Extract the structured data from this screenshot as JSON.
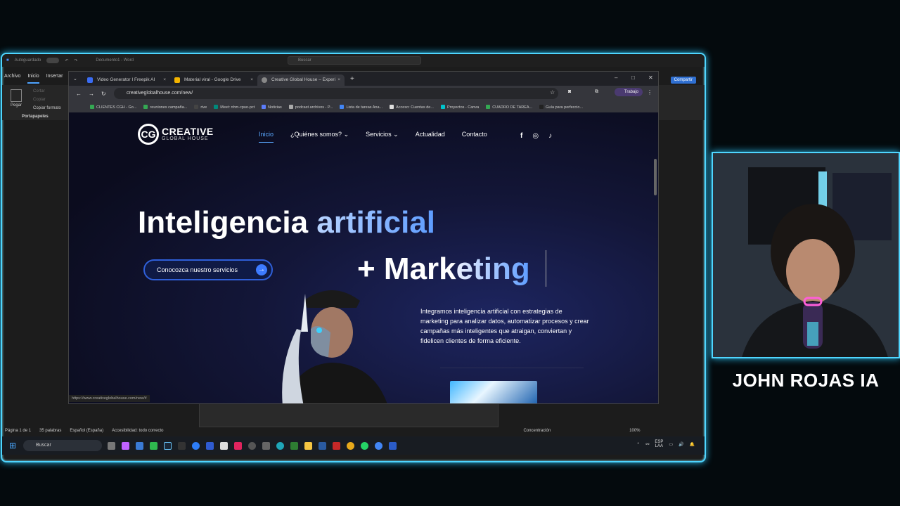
{
  "word": {
    "autosave_label": "Autoguardado",
    "title": "Documento1 - Word",
    "search_placeholder": "Buscar",
    "tabs": [
      "Archivo",
      "Inicio",
      "Insertar"
    ],
    "active_tab": "Inicio",
    "share_label": "Compartir",
    "ribbon": {
      "paste": "Pegar",
      "cut": "Cortar",
      "copy": "Copiar",
      "format": "Copiar formato",
      "group": "Portapapeles"
    },
    "status": {
      "page": "Página 1 de 1",
      "words": "35 palabras",
      "language": "Español (España)",
      "accessibility": "Accesibilidad: todo correcto",
      "focus": "Concentración",
      "zoom": "100%"
    }
  },
  "browser": {
    "tabs": [
      {
        "title": "Video Generator I Freepik AI",
        "color": "#3a6cf4"
      },
      {
        "title": "Material viral - Google Drive",
        "color": "#f4b400"
      },
      {
        "title": "Creative Global House – Experi",
        "color": "#888888"
      }
    ],
    "url": "creativeglobalhouse.com/new/",
    "profile_label": "Trabajo",
    "bookmarks": [
      {
        "label": "CLIENTES CGH - Go...",
        "color": "#34a853"
      },
      {
        "label": "reuniones campaña...",
        "color": "#34a853"
      },
      {
        "label": "rive",
        "color": "#444444"
      },
      {
        "label": "Meet: nhm-cpuo-pct",
        "color": "#00897b"
      },
      {
        "label": "Noticias",
        "color": "#5b7cfa"
      },
      {
        "label": "podcast archivos - P...",
        "color": "#aaaaaa"
      },
      {
        "label": "Lista de tareas Ana...",
        "color": "#4285f4"
      },
      {
        "label": "Acceso: Cuentas de...",
        "color": "#dddddd"
      },
      {
        "label": "Proyectos - Canva",
        "color": "#00c4cc"
      },
      {
        "label": "CUADRO DE TAREA...",
        "color": "#34a853"
      },
      {
        "label": "Guía para perfeccio...",
        "color": "#222222"
      }
    ],
    "status_url": "https://www.creativeglobalhouse.com/new/#"
  },
  "site": {
    "logo_mark": "CG",
    "logo_line1": "CREATIVE",
    "logo_line2": "GLOBAL HOUSE",
    "nav": [
      "Inicio",
      "¿Quiénes somos?",
      "Servicios",
      "Actualidad",
      "Contacto"
    ],
    "active_nav": "Inicio",
    "headline_white": "Inteligencia ",
    "headline_accent": "artificial",
    "subhead_plus": "+ Mark",
    "subhead_accent": "eting",
    "cta_label": "Conozca nuestro servicios",
    "cta_display": "Conocozca nuestro servicios",
    "paragraph": "Integramos inteligencia artificial con estrategias de marketing para analizar datos, automatizar procesos y crear campañas más inteligentes que atraigan, conviertan y fidelicen clientes de forma eficiente."
  },
  "taskbar": {
    "search_label": "Buscar",
    "lang1": "ESP",
    "lang2": "LAA"
  },
  "camera": {
    "name": "JOHN ROJAS IA"
  },
  "colors": {
    "accent": "#4fd6ff",
    "brand_blue": "#3d7bff"
  }
}
